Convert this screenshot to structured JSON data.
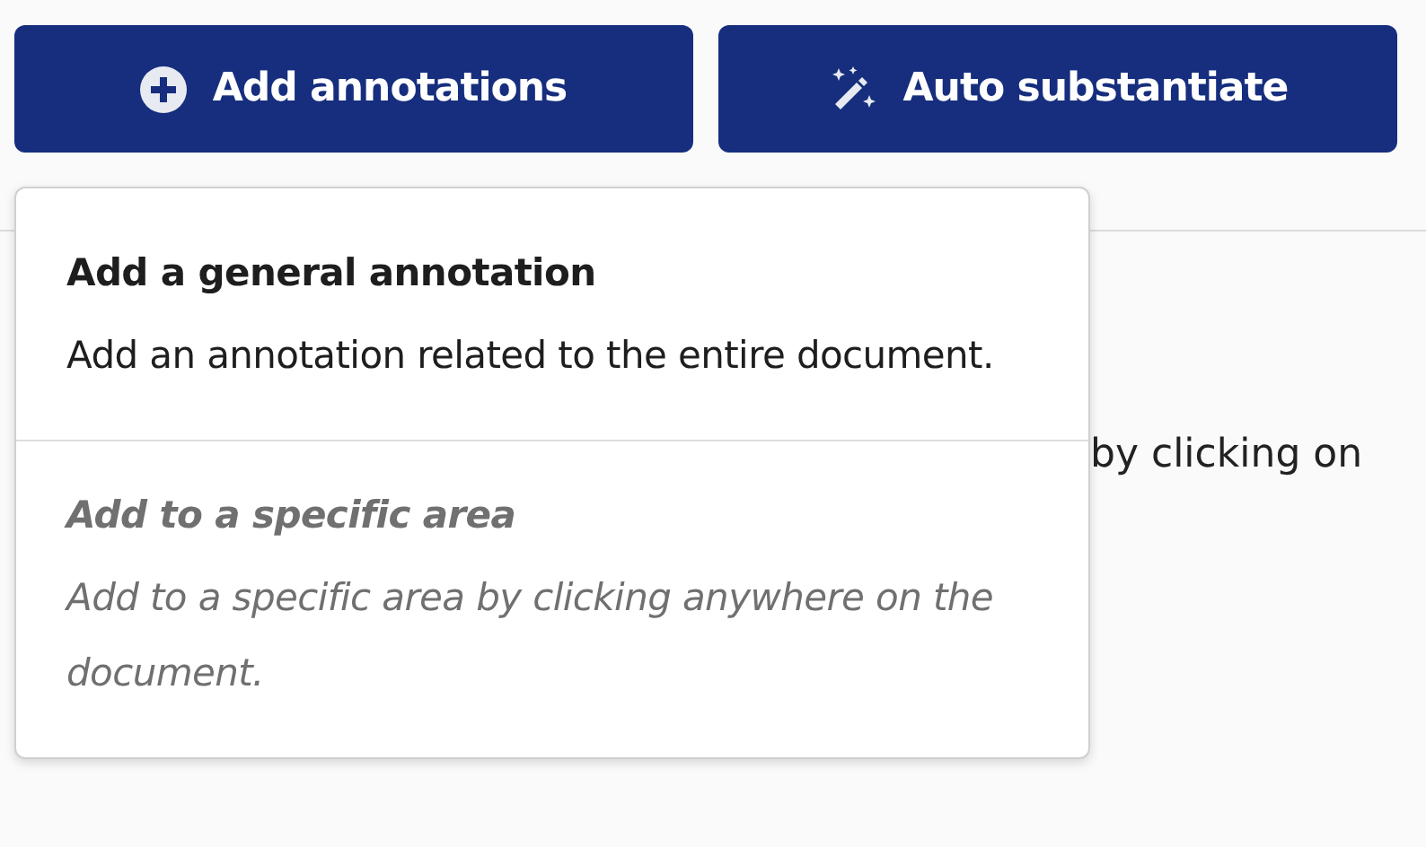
{
  "toolbar": {
    "buttons": [
      {
        "label": "Add annotations",
        "kind": "add"
      },
      {
        "label": "Auto substantiate",
        "kind": "magic"
      }
    ]
  },
  "document": {
    "text": "by clicking on"
  },
  "menu": {
    "items": [
      {
        "title": "Add a general annotation",
        "description": "Add an annotation related to the entire document.",
        "disabled": false
      },
      {
        "title": "Add to a specific area",
        "description": "Add to a specific area by clicking anywhere on the document.",
        "disabled": true
      }
    ]
  }
}
